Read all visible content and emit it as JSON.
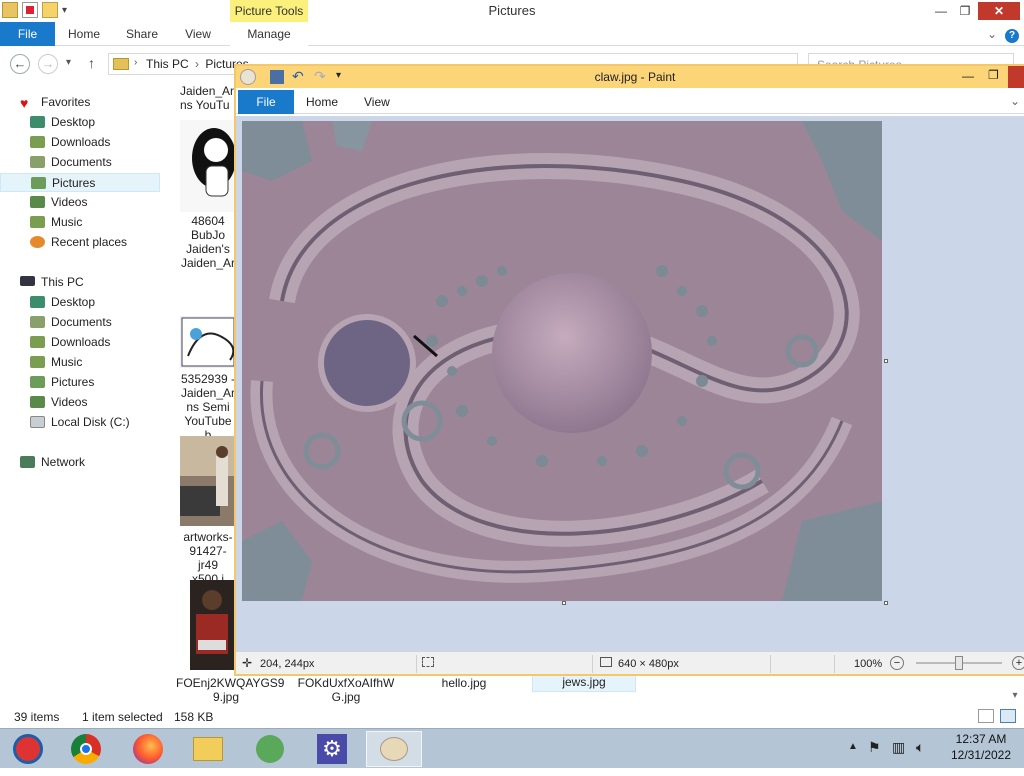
{
  "explorer": {
    "title": "Pictures",
    "picture_tools": "Picture Tools",
    "tabs": {
      "file": "File",
      "home": "Home",
      "share": "Share",
      "view": "View",
      "manage": "Manage"
    },
    "breadcrumb": [
      "This PC",
      "Pictures"
    ],
    "search_placeholder": "Search Pictures",
    "nav": {
      "favorites": "Favorites",
      "fav_items": [
        "Desktop",
        "Downloads",
        "Documents",
        "Pictures",
        "Videos",
        "Music",
        "Recent places"
      ],
      "this_pc": "This PC",
      "pc_items": [
        "Desktop",
        "Documents",
        "Downloads",
        "Music",
        "Pictures",
        "Videos",
        "Local Disk (C:)"
      ],
      "network": "Network"
    },
    "files": {
      "f1": [
        "Jaiden_Ar",
        "ns YouTu"
      ],
      "f2": [
        "48604",
        "BubJo",
        "Jaiden's",
        "Jaiden_Ar"
      ],
      "f3": [
        "5352939 -",
        "Jaiden_Ar",
        "ns Semi",
        "YouTube b"
      ],
      "f4": [
        "artworks-",
        "91427-jr49",
        "x500.j"
      ],
      "f5": [
        "FOEnj2KWQAYGS9",
        "9.jpg"
      ],
      "f6": [
        "FOKdUxfXoAIfhW",
        "G.jpg"
      ],
      "f7": [
        "hello.jpg"
      ],
      "f8": [
        "jews.jpg"
      ]
    },
    "status": {
      "items": "39 items",
      "selected": "1 item selected",
      "size": "158 KB"
    }
  },
  "paint": {
    "title": "claw.jpg - Paint",
    "tabs": {
      "file": "File",
      "home": "Home",
      "view": "View"
    },
    "status": {
      "cursor": "204, 244px",
      "dimensions": "640 × 480px",
      "zoom": "100%"
    },
    "zoom_level": 0.5
  },
  "taskbar": {
    "apps": [
      "media-player-icon",
      "chrome-icon",
      "firefox-icon",
      "file-explorer-icon",
      "network-user-icon",
      "settings-gear-icon",
      "paint-palette-icon"
    ],
    "time": "12:37 AM",
    "date": "12/31/2022"
  },
  "colors": {
    "accent": "#1979ca",
    "paint_frame": "#fbd578",
    "picture_tools": "#fcf07c",
    "taskbar": "#b4c6d6"
  }
}
